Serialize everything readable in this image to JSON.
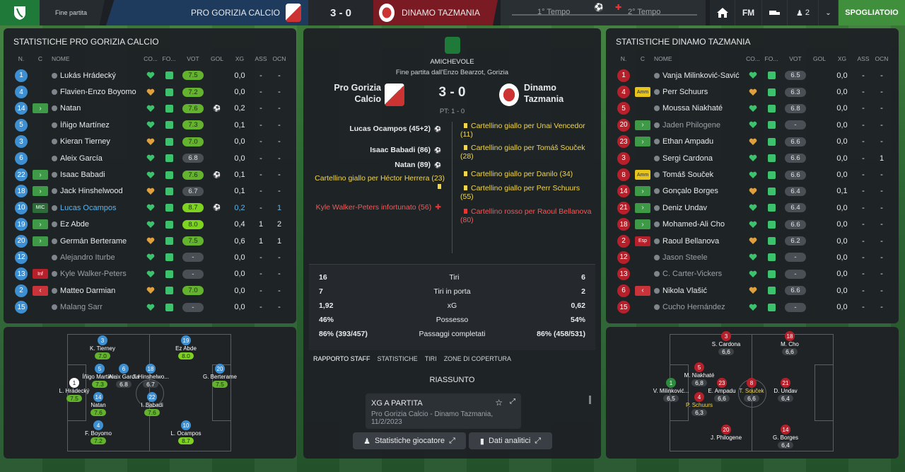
{
  "topbar": {
    "status": "Fine partita",
    "home_team": "PRO GORIZIA CALCIO",
    "score": "3 - 0",
    "away_team": "DINAMO TAZMANIA",
    "first_half": "1° Tempo",
    "second_half": "2° Tempo",
    "fm_label": "FM",
    "users_count": "2",
    "continue_button": "SPOGLIATOIO"
  },
  "left": {
    "title": "STATISTICHE PRO GORIZIA CALCIO",
    "headers": {
      "n": "N.",
      "c": "C",
      "name": "NOME",
      "co": "CO...",
      "fo": "FO...",
      "vot": "VOT",
      "gol": "GOL",
      "xg": "XG",
      "ass": "ASS",
      "ocn": "OCN"
    },
    "players": [
      {
        "n": "1",
        "c": "",
        "name": "Lukás Hrádecký",
        "vot": "7.5",
        "gol": "",
        "xg": "0,0",
        "ass": "-",
        "ocn": "-"
      },
      {
        "n": "4",
        "c": "",
        "name": "Flavien-Enzo Boyomo",
        "vot": "7.2",
        "gol": "",
        "xg": "0,0",
        "ass": "-",
        "ocn": "-"
      },
      {
        "n": "14",
        "c": "in",
        "name": "Natan",
        "vot": "7.6",
        "gol": "ball",
        "xg": "0,2",
        "ass": "-",
        "ocn": "-"
      },
      {
        "n": "5",
        "c": "",
        "name": "Íñigo Martínez",
        "vot": "7.3",
        "gol": "",
        "xg": "0,1",
        "ass": "-",
        "ocn": "-"
      },
      {
        "n": "3",
        "c": "",
        "name": "Kieran Tierney",
        "vot": "7.0",
        "gol": "",
        "xg": "0,0",
        "ass": "-",
        "ocn": "-"
      },
      {
        "n": "6",
        "c": "",
        "name": "Aleix García",
        "vot": "6.8",
        "gol": "",
        "xg": "0,0",
        "ass": "-",
        "ocn": "-"
      },
      {
        "n": "22",
        "c": "in",
        "name": "Isaac Babadi",
        "vot": "7.6",
        "gol": "ball",
        "xg": "0,1",
        "ass": "-",
        "ocn": "-"
      },
      {
        "n": "18",
        "c": "in",
        "name": "Jack Hinshelwood",
        "vot": "6.7",
        "gol": "",
        "xg": "0,1",
        "ass": "-",
        "ocn": "-"
      },
      {
        "n": "10",
        "c": "MIC",
        "name": "Lucas Ocampos",
        "vot": "8.7",
        "gol": "ball",
        "xg": "0,2",
        "ass": "-",
        "ocn": "1"
      },
      {
        "n": "19",
        "c": "in",
        "name": "Ez Abde",
        "vot": "8.0",
        "gol": "",
        "xg": "0,4",
        "ass": "1",
        "ocn": "2"
      },
      {
        "n": "20",
        "c": "in",
        "name": "Germán Berterame",
        "vot": "7.5",
        "gol": "",
        "xg": "0,6",
        "ass": "1",
        "ocn": "1"
      },
      {
        "n": "12",
        "c": "",
        "name": "Alejandro Iturbe",
        "vot": "-",
        "gol": "",
        "xg": "0,0",
        "ass": "-",
        "ocn": "-"
      },
      {
        "n": "13",
        "c": "Inf",
        "name": "Kyle Walker-Peters",
        "vot": "-",
        "gol": "",
        "xg": "0,0",
        "ass": "-",
        "ocn": "-"
      },
      {
        "n": "2",
        "c": "out",
        "name": "Matteo Darmian",
        "vot": "7.0",
        "gol": "",
        "xg": "0,0",
        "ass": "-",
        "ocn": "-"
      },
      {
        "n": "15",
        "c": "",
        "name": "Malang Sarr",
        "vot": "-",
        "gol": "",
        "xg": "0,0",
        "ass": "-",
        "ocn": "-"
      }
    ],
    "pitch": [
      {
        "n": "3",
        "name": "K. Tierney",
        "r": "7.0"
      },
      {
        "n": "19",
        "name": "Ez Abde",
        "r": "8.0"
      },
      {
        "n": "1",
        "name": "L. Hrádecký",
        "r": "7.5"
      },
      {
        "n": "5",
        "name": "Íñigo Martín...",
        "r": "7.3"
      },
      {
        "n": "6",
        "name": "Aleix García",
        "r": "6.8"
      },
      {
        "n": "18",
        "name": "J. Hinshelwo...",
        "r": "6.7"
      },
      {
        "n": "20",
        "name": "G. Berterame",
        "r": "7.5"
      },
      {
        "n": "14",
        "name": "Natan",
        "r": "7.6"
      },
      {
        "n": "22",
        "name": "I. Babadi",
        "r": "7.6"
      },
      {
        "n": "4",
        "name": "F. Boyomo",
        "r": "7.2"
      },
      {
        "n": "10",
        "name": "L. Ocampos",
        "r": "8.7"
      }
    ]
  },
  "center": {
    "competition": "AMICHEVOLE",
    "venue": "Fine partita dall'Enzo Bearzot, Gorizia",
    "home": "Pro Gorizia Calcio",
    "away": "Dinamo Tazmania",
    "score": "3 - 0",
    "halftime": "PT: 1 - 0",
    "home_events": [
      {
        "text": "Lucas Ocampos (45+2)",
        "type": "goal"
      },
      {
        "text": "Isaac Babadi (86)",
        "type": "goal"
      },
      {
        "text": "Natan (89)",
        "type": "goal"
      },
      {
        "text": "Cartellino giallo per Héctor Herrera (23)",
        "type": "yellow"
      },
      {
        "text": "Kyle Walker-Peters infortunato (56)",
        "type": "injury"
      }
    ],
    "away_events": [
      {
        "text": "Cartellino giallo per Unai Vencedor (11)",
        "type": "yellow"
      },
      {
        "text": "Cartellino giallo per Tomáš Souček (28)",
        "type": "yellow"
      },
      {
        "text": "Cartellino giallo per Danilo (34)",
        "type": "yellow"
      },
      {
        "text": "Cartellino giallo per Perr Schuurs (55)",
        "type": "yellow"
      },
      {
        "text": "Cartellino rosso per Raoul Bellanova (80)",
        "type": "red"
      }
    ],
    "stats": [
      {
        "h": "16",
        "label": "Tiri",
        "a": "6"
      },
      {
        "h": "7",
        "label": "Tiri in porta",
        "a": "2"
      },
      {
        "h": "1,92",
        "label": "xG",
        "a": "0,62"
      },
      {
        "h": "46%",
        "label": "Possesso",
        "a": "54%"
      },
      {
        "h": "86% (393/457)",
        "label": "Passaggi completati",
        "a": "86% (458/531)"
      }
    ],
    "tabs": [
      "RAPPORTO STAFF",
      "STATISTICHE",
      "TIRI",
      "ZONE DI COPERTURA"
    ],
    "summary_title": "RIASSUNTO",
    "card_title": "XG A PARTITA",
    "card_sub": "Pro Gorizia Calcio - Dinamo Tazmania,",
    "card_date": "11/2/2023",
    "btn_players": "Statistiche giocatore",
    "btn_analytics": "Dati analitici"
  },
  "right": {
    "title": "STATISTICHE DINAMO TAZMANIA",
    "players": [
      {
        "n": "1",
        "c": "",
        "name": "Vanja Milinković-Savić",
        "vot": "6.5",
        "xg": "0,0",
        "ass": "-",
        "ocn": "-"
      },
      {
        "n": "4",
        "c": "Amm",
        "name": "Perr Schuurs",
        "vot": "6.3",
        "xg": "0,0",
        "ass": "-",
        "ocn": "-"
      },
      {
        "n": "5",
        "c": "",
        "name": "Moussa Niakhaté",
        "vot": "6.8",
        "xg": "0,0",
        "ass": "-",
        "ocn": "-"
      },
      {
        "n": "20",
        "c": "in",
        "name": "Jaden Philogene",
        "vot": "-",
        "xg": "0,0",
        "ass": "-",
        "ocn": "-"
      },
      {
        "n": "23",
        "c": "in",
        "name": "Ethan Ampadu",
        "vot": "6.6",
        "xg": "0,0",
        "ass": "-",
        "ocn": "-"
      },
      {
        "n": "3",
        "c": "",
        "name": "Sergi Cardona",
        "vot": "6.6",
        "xg": "0,0",
        "ass": "-",
        "ocn": "1"
      },
      {
        "n": "8",
        "c": "Amm",
        "name": "Tomáš Souček",
        "vot": "6.6",
        "xg": "0,0",
        "ass": "-",
        "ocn": "-"
      },
      {
        "n": "14",
        "c": "in",
        "name": "Gonçalo Borges",
        "vot": "6.4",
        "xg": "0,1",
        "ass": "-",
        "ocn": "-"
      },
      {
        "n": "21",
        "c": "in",
        "name": "Deniz Undav",
        "vot": "6.4",
        "xg": "0,0",
        "ass": "-",
        "ocn": "-"
      },
      {
        "n": "18",
        "c": "in",
        "name": "Mohamed-Ali Cho",
        "vot": "6.6",
        "xg": "0,0",
        "ass": "-",
        "ocn": "-"
      },
      {
        "n": "2",
        "c": "Esp",
        "name": "Raoul Bellanova",
        "vot": "6.2",
        "xg": "0,0",
        "ass": "-",
        "ocn": "-"
      },
      {
        "n": "12",
        "c": "",
        "name": "Jason Steele",
        "vot": "-",
        "xg": "0,0",
        "ass": "-",
        "ocn": "-"
      },
      {
        "n": "13",
        "c": "",
        "name": "C. Carter-Vickers",
        "vot": "-",
        "xg": "0,0",
        "ass": "-",
        "ocn": "-"
      },
      {
        "n": "6",
        "c": "out",
        "name": "Nikola Vlašić",
        "vot": "6.6",
        "xg": "0,0",
        "ass": "-",
        "ocn": "-"
      },
      {
        "n": "15",
        "c": "",
        "name": "Cucho Hernández",
        "vot": "-",
        "xg": "0,0",
        "ass": "-",
        "ocn": "-"
      }
    ],
    "pitch": [
      {
        "n": "3",
        "name": "S. Cardona",
        "r": "6,6"
      },
      {
        "n": "18",
        "name": "M. Cho",
        "r": "6,6"
      },
      {
        "n": "5",
        "name": "M. Niakhaté",
        "r": "6,8"
      },
      {
        "n": "1",
        "name": "V. Milinković...",
        "r": "6,5"
      },
      {
        "n": "23",
        "name": "E. Ampadu",
        "r": "6,6"
      },
      {
        "n": "8",
        "name": "T. Souček",
        "r": "6,6"
      },
      {
        "n": "21",
        "name": "D. Undav",
        "r": "6,4"
      },
      {
        "n": "4",
        "name": "P. Schuurs",
        "r": "6,3"
      },
      {
        "n": "20",
        "name": "J. Philogene",
        "r": ""
      },
      {
        "n": "14",
        "name": "G. Borges",
        "r": "6,4"
      }
    ]
  },
  "colors": {
    "home": "#1e3a5c",
    "away": "#7a1a22",
    "accent": "#3f8f3c",
    "good": "#7ed321"
  }
}
